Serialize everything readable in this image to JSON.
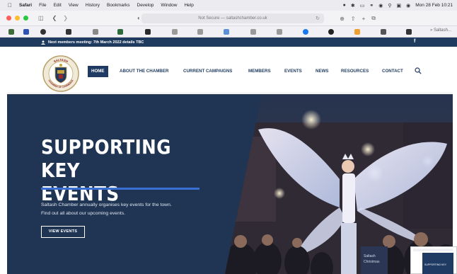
{
  "menubar": {
    "items": [
      "Safari",
      "File",
      "Edit",
      "View",
      "History",
      "Bookmarks",
      "Develop",
      "Window",
      "Help"
    ],
    "datetime": "Mon 28 Feb  10:21"
  },
  "browser": {
    "address": "Not Secure — saltashchamber.co.uk",
    "bookmark_end_label": "» Saltash..."
  },
  "site": {
    "notice": "Next members meeting: 7th March 2022 details TBC",
    "facebook_label": "f",
    "logo_text_top": "SALTASH",
    "logo_text_bottom": "CHAMBER OF COMMERCE",
    "nav": [
      "HOME",
      "ABOUT THE CHAMBER",
      "CURRENT CAMPAIGNS",
      "MEMBERS",
      "EVENTS",
      "NEWS",
      "RESOURCES",
      "CONTACT"
    ],
    "hero": {
      "title_line1": "SUPPORTING KEY",
      "title_line2": "EVENTS",
      "text_line1": "Saltash Chamber annually organises key events for the town.",
      "text_line2": "Find out all about our upcoming events.",
      "button": "VIEW EVENTS"
    },
    "thumb_caption": "SUPPORTING KEY"
  },
  "colors": {
    "navy": "#1e3a5e",
    "accent_blue": "#3a6fd4"
  }
}
